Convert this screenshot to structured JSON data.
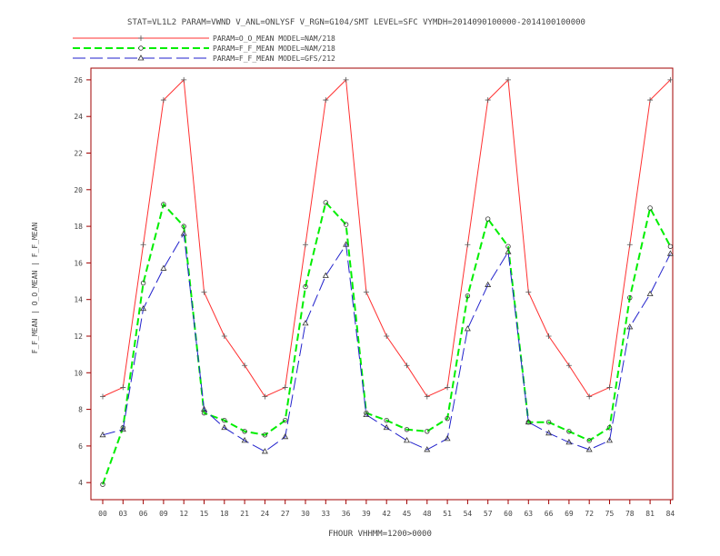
{
  "chart_data": {
    "type": "line",
    "title": "STAT=VL1L2 PARAM=VWND V_ANL=ONLYSF V_RGN=G104/SMT LEVEL=SFC VYMDH=2014090100000-2014100100000",
    "xlabel": "FHOUR VHHMM=1200>0000",
    "ylabel": "F_F_MEAN | O_O_MEAN | F_F_MEAN",
    "categories": [
      "00",
      "03",
      "06",
      "09",
      "12",
      "15",
      "18",
      "21",
      "24",
      "27",
      "30",
      "33",
      "36",
      "39",
      "42",
      "45",
      "48",
      "51",
      "54",
      "57",
      "60",
      "63",
      "66",
      "69",
      "72",
      "75",
      "78",
      "81",
      "84"
    ],
    "yticks": [
      4,
      6,
      8,
      10,
      12,
      14,
      16,
      18,
      20,
      22,
      24,
      26
    ],
    "ylim": [
      3,
      26.5
    ],
    "grid": false,
    "legend_position": "top-left",
    "series": [
      {
        "name": "PARAM=O_O_MEAN MODEL=NAM/218",
        "color": "#ff3030",
        "dash": "solid",
        "marker": "plus",
        "values": [
          8.7,
          9.2,
          17.0,
          24.9,
          26.0,
          14.4,
          12.0,
          10.4,
          8.7,
          9.2,
          17.0,
          24.9,
          26.0,
          14.4,
          12.0,
          10.4,
          8.7,
          9.2,
          17.0,
          24.9,
          26.0,
          14.4,
          12.0,
          10.4,
          8.7,
          9.2,
          17.0,
          24.9,
          26.0
        ]
      },
      {
        "name": "PARAM=F_F_MEAN MODEL=NAM/218",
        "color": "#00ee00",
        "dash": "dashed",
        "marker": "circle",
        "values": [
          3.9,
          7.0,
          14.9,
          19.2,
          18.0,
          7.8,
          7.4,
          6.8,
          6.6,
          7.4,
          14.7,
          19.3,
          18.1,
          7.8,
          7.4,
          6.9,
          6.8,
          7.5,
          14.2,
          18.4,
          16.9,
          7.3,
          7.3,
          6.8,
          6.3,
          7.0,
          14.1,
          19.0,
          16.9
        ]
      },
      {
        "name": "PARAM=F_F_MEAN MODEL=GFS/212",
        "color": "#2222cc",
        "dash": "longdash",
        "marker": "triangle",
        "values": [
          6.6,
          6.9,
          13.5,
          15.7,
          17.6,
          8.0,
          7.0,
          6.3,
          5.7,
          6.5,
          12.7,
          15.3,
          17.0,
          7.7,
          7.0,
          6.3,
          5.8,
          6.4,
          12.4,
          14.8,
          16.6,
          7.3,
          6.7,
          6.2,
          5.8,
          6.3,
          12.5,
          14.3,
          16.5
        ]
      }
    ]
  }
}
